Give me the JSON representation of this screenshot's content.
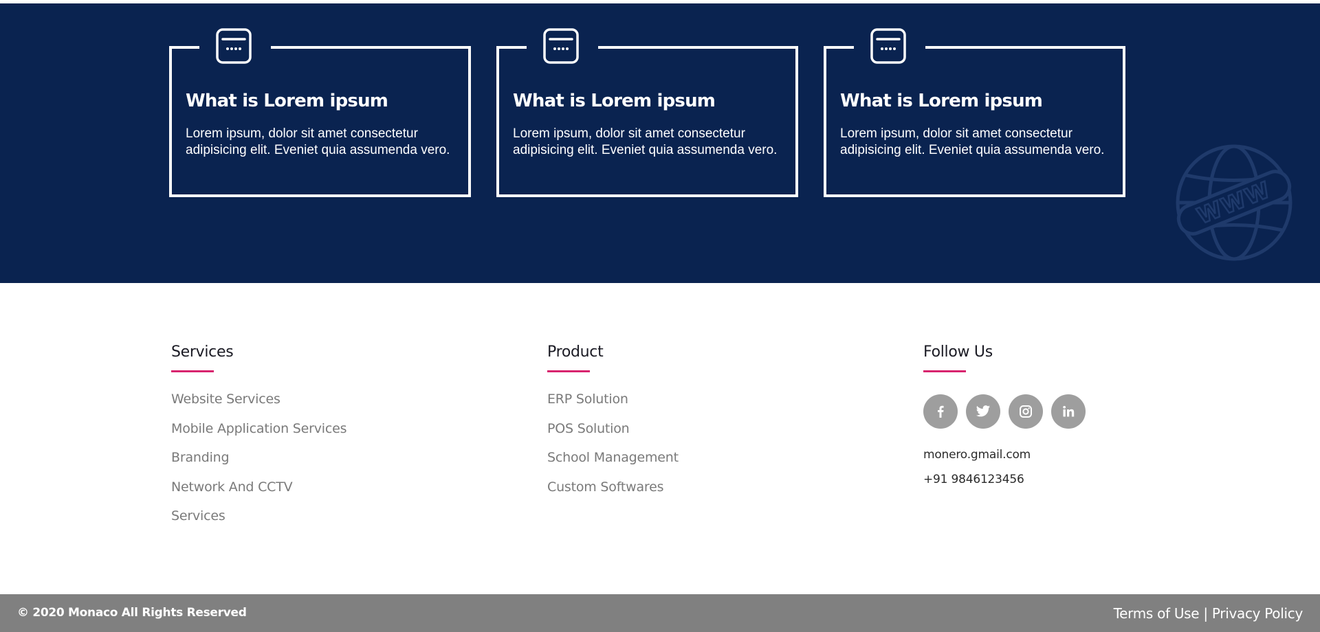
{
  "colors": {
    "band_bg": "#0a2350",
    "accent": "#d8246e",
    "social_bg": "#9e9e9e",
    "bottom_bar_bg": "#808080"
  },
  "features": [
    {
      "icon": "browser-window-icon",
      "title": "What is Lorem ipsum",
      "text": "Lorem ipsum, dolor sit amet consectetur adipisicing elit. Eveniet quia assumenda vero."
    },
    {
      "icon": "browser-window-icon",
      "title": "What is Lorem ipsum",
      "text": "Lorem ipsum, dolor sit amet consectetur adipisicing elit. Eveniet quia assumenda vero."
    },
    {
      "icon": "browser-window-icon",
      "title": "What is Lorem ipsum",
      "text": "Lorem ipsum, dolor sit amet consectetur adipisicing elit. Eveniet quia assumenda vero."
    }
  ],
  "decor": {
    "globe_icon": "www-globe-icon",
    "globe_text": "WWW"
  },
  "footer": {
    "services": {
      "title": "Services",
      "items": [
        "Website Services",
        "Mobile Application Services",
        "Branding",
        "Network And CCTV",
        "Services"
      ]
    },
    "product": {
      "title": "Product",
      "items": [
        "ERP Solution",
        "POS Solution",
        "School Management",
        "Custom Softwares"
      ]
    },
    "follow": {
      "title": "Follow Us",
      "socials": [
        {
          "name": "facebook",
          "icon": "facebook-icon"
        },
        {
          "name": "twitter",
          "icon": "twitter-icon"
        },
        {
          "name": "instagram",
          "icon": "instagram-icon"
        },
        {
          "name": "linkedin",
          "icon": "linkedin-icon"
        }
      ],
      "email": "monero.gmail.com",
      "phone": "+91 9846123456"
    }
  },
  "bottom": {
    "copyright": "© 2020 Monaco All Rights Reserved",
    "terms": "Terms of Use",
    "separator": "|",
    "privacy": "Privacy Policy"
  }
}
